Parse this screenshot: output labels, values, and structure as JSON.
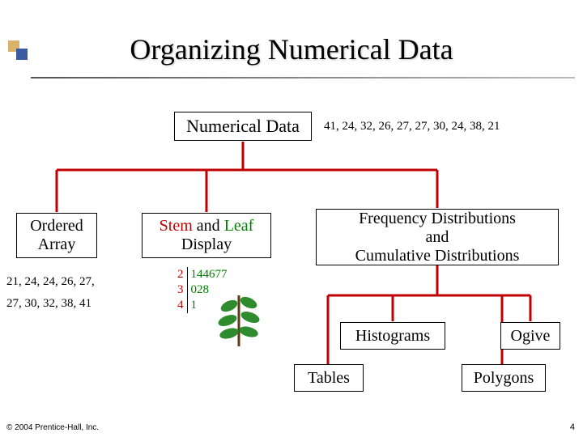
{
  "title": "Organizing Numerical Data",
  "root_label": "Numerical Data",
  "sample_values": "41, 24, 32, 26, 27, 27, 30, 24, 38, 21",
  "ordered": {
    "line1": "Ordered",
    "line2": "Array"
  },
  "stem": {
    "word1": "Stem",
    "word_and": " and ",
    "word2": "Leaf",
    "line2": "Display"
  },
  "freq": {
    "line1": "Frequency Distributions",
    "line2": "and",
    "line3": "Cumulative Distributions"
  },
  "histograms": "Histograms",
  "ogive": "Ogive",
  "tables": "Tables",
  "polygons": "Polygons",
  "ordered_data": {
    "line1": "21, 24, 24, 26, 27,",
    "line2": "27, 30, 32, 38, 41"
  },
  "stemleaf_rows": {
    "r1s": "2",
    "r1l": "144677",
    "r2s": "3",
    "r2l": "028",
    "r3s": "4",
    "r3l": "1"
  },
  "copyright": "© 2004 Prentice-Hall, Inc.",
  "page": "4"
}
